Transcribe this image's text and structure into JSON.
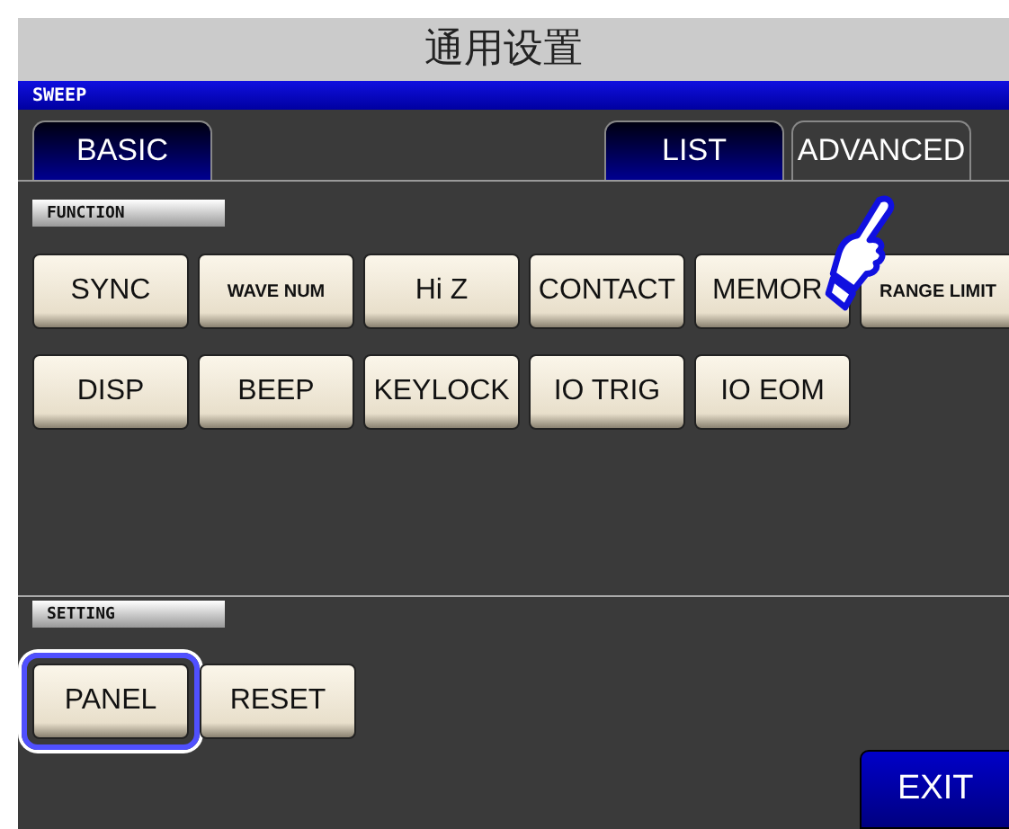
{
  "title": "通用设置",
  "mode": "SWEEP",
  "tabs": [
    {
      "label": "BASIC",
      "selected": false
    },
    {
      "label": "LIST",
      "selected": false
    },
    {
      "label": "ADVANCED",
      "selected": true
    }
  ],
  "function": {
    "label": "FUNCTION",
    "buttons": [
      {
        "label": "SYNC",
        "kind": "large"
      },
      {
        "label": "WAVE NUM",
        "kind": "small"
      },
      {
        "label": "Hi Z",
        "kind": "large"
      },
      {
        "label": "CONTACT",
        "kind": "large"
      },
      {
        "label": "MEMOR",
        "kind": "partial"
      },
      {
        "label": "RANGE LIMIT",
        "kind": "small"
      },
      {
        "label": "DISP",
        "kind": "large"
      },
      {
        "label": "BEEP",
        "kind": "large"
      },
      {
        "label": "KEYLOCK",
        "kind": "large"
      },
      {
        "label": "IO TRIG",
        "kind": "large"
      },
      {
        "label": "IO EOM",
        "kind": "large"
      }
    ]
  },
  "setting": {
    "label": "SETTING",
    "buttons": [
      {
        "label": "PANEL",
        "highlighted": true
      },
      {
        "label": "RESET",
        "highlighted": false
      }
    ]
  },
  "exit": "EXIT"
}
